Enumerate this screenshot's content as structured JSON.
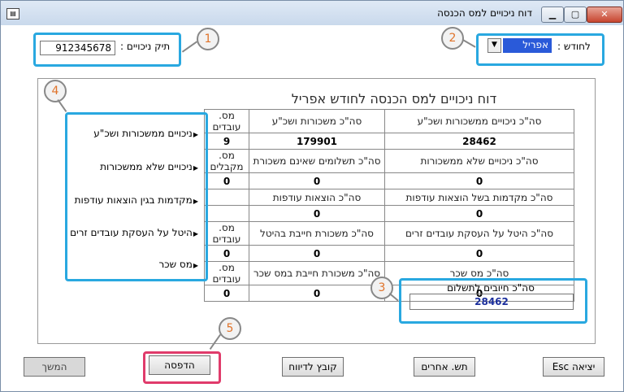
{
  "window": {
    "title": "דוח ניכויים למס הכנסה",
    "close_glyph": "✕",
    "max_glyph": "▢",
    "min_glyph": "▁",
    "app_icon": "window-app-icon"
  },
  "header": {
    "file_label": "תיק ניכויים :",
    "file_value": "912345678",
    "month_label": "לחודש :",
    "month_value": "אפריל"
  },
  "callouts": [
    "1",
    "2",
    "3",
    "4",
    "5"
  ],
  "report": {
    "title": "דוח ניכויים למס הכנסה לחודש אפריל",
    "rows": [
      {
        "label": "ניכויים ממשכורות ושכ\"ע",
        "headers": [
          "סה\"כ ניכויים ממשכורות ושכ\"ע",
          "סה\"כ משכורות ושכ\"ע",
          "מס. עובדים"
        ],
        "values": [
          "28462",
          "179901",
          "9"
        ]
      },
      {
        "label": "ניכויים שלא ממשכורות",
        "headers": [
          "סה\"כ ניכויים שלא ממשכורות",
          "סה\"כ תשלומים שאינם משכורת",
          "מס. מקבלים"
        ],
        "values": [
          "0",
          "0",
          "0"
        ]
      },
      {
        "label": "מקדמות בגין הוצאות עודפות",
        "headers": [
          "סה\"כ מקדמות בשל הוצאות עודפות",
          "סה\"כ הוצאות עודפות",
          ""
        ],
        "values": [
          "0",
          "0",
          ""
        ]
      },
      {
        "label": "היטל על העסקת עובדים זרים",
        "headers": [
          "סה\"כ היטל על העסקת עובדים זרים",
          "סה\"כ משכורת חייבת בהיטל",
          "מס. עובדים"
        ],
        "values": [
          "0",
          "0",
          "0"
        ]
      },
      {
        "label": "מס שכר",
        "headers": [
          "סה\"כ מס שכר",
          "סה\"כ משכורת חייבת במס שכר",
          "מס. עובדים"
        ],
        "values": [
          "0",
          "0",
          "0"
        ]
      }
    ],
    "total_label": "סה\"כ חיובים לתשלום",
    "total_value": "28462"
  },
  "buttons": {
    "next": "המשך",
    "print": "הדפסה",
    "report_file": "קובץ לדיווח",
    "other_payments": "תש. אחרים",
    "exit": "יציאה Esc"
  },
  "colors": {
    "callout": "#29a8e0",
    "callout_highlight": "#e03b6b",
    "number": "#e0732a",
    "selected": "#2a5ad9",
    "total": "#1b2e9c"
  }
}
